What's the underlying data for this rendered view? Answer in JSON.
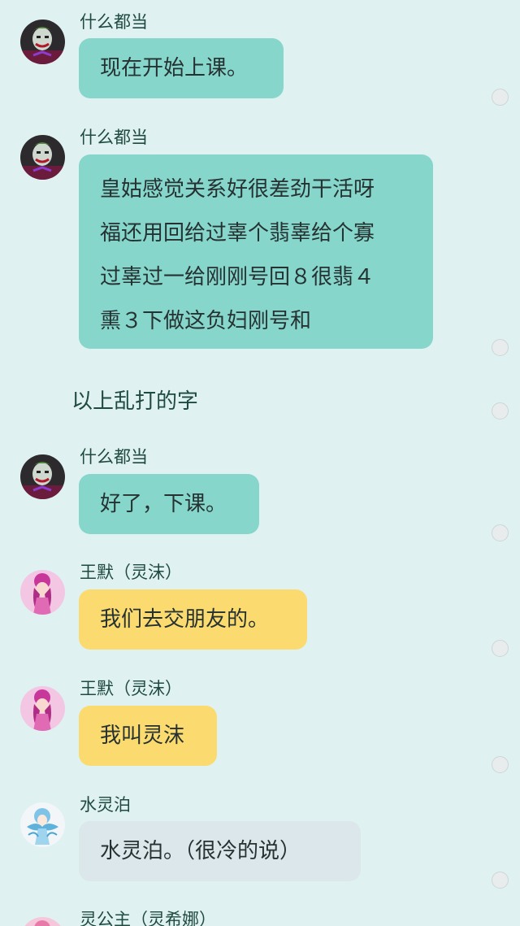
{
  "messages": [
    {
      "sender": "什么都当",
      "text": "现在开始上课。",
      "color": "#86d6cb"
    },
    {
      "sender": "什么都当",
      "lines": [
        "皇姑感觉关系好很差劲干活呀",
        "福还用回给过辜个翡辜给个寡",
        "过辜过一给刚刚号回８很翡４",
        "熏３下做这负妇刚号和"
      ],
      "color": "#86d6cb"
    },
    {
      "narration": "以上乱打的字"
    },
    {
      "sender": "什么都当",
      "text": "好了，下课。",
      "color": "#86d6cb"
    },
    {
      "sender": "王默（灵沫）",
      "text": "我们去交朋友的。",
      "color": "#fbdb6f"
    },
    {
      "sender": "王默（灵沫）",
      "text": "我叫灵沫",
      "color": "#fbdb6f"
    },
    {
      "sender": "水灵泊",
      "text": "水灵泊。（很冷的说）",
      "color": "#dce7ec"
    },
    {
      "sender": "灵公主（灵希娜）"
    }
  ],
  "avatars": {
    "joker": "joker-figure-icon",
    "pink_doll": "pink-doll-icon",
    "blue_fairy": "blue-fairy-icon",
    "pink_girl": "pink-girl-icon"
  },
  "background": "#dff1f1"
}
